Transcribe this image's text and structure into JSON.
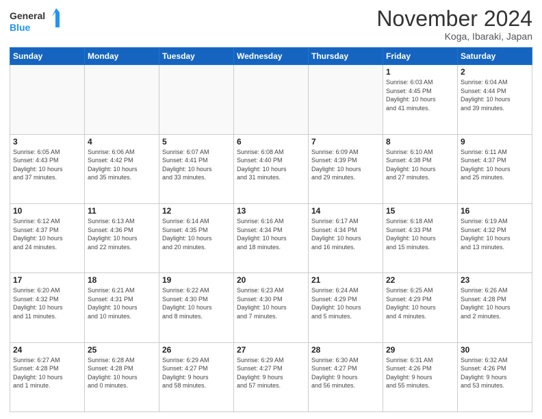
{
  "header": {
    "logo_line1": "General",
    "logo_line2": "Blue",
    "month": "November 2024",
    "location": "Koga, Ibaraki, Japan"
  },
  "weekdays": [
    "Sunday",
    "Monday",
    "Tuesday",
    "Wednesday",
    "Thursday",
    "Friday",
    "Saturday"
  ],
  "weeks": [
    [
      {
        "day": "",
        "info": ""
      },
      {
        "day": "",
        "info": ""
      },
      {
        "day": "",
        "info": ""
      },
      {
        "day": "",
        "info": ""
      },
      {
        "day": "",
        "info": ""
      },
      {
        "day": "1",
        "info": "Sunrise: 6:03 AM\nSunset: 4:45 PM\nDaylight: 10 hours\nand 41 minutes."
      },
      {
        "day": "2",
        "info": "Sunrise: 6:04 AM\nSunset: 4:44 PM\nDaylight: 10 hours\nand 39 minutes."
      }
    ],
    [
      {
        "day": "3",
        "info": "Sunrise: 6:05 AM\nSunset: 4:43 PM\nDaylight: 10 hours\nand 37 minutes."
      },
      {
        "day": "4",
        "info": "Sunrise: 6:06 AM\nSunset: 4:42 PM\nDaylight: 10 hours\nand 35 minutes."
      },
      {
        "day": "5",
        "info": "Sunrise: 6:07 AM\nSunset: 4:41 PM\nDaylight: 10 hours\nand 33 minutes."
      },
      {
        "day": "6",
        "info": "Sunrise: 6:08 AM\nSunset: 4:40 PM\nDaylight: 10 hours\nand 31 minutes."
      },
      {
        "day": "7",
        "info": "Sunrise: 6:09 AM\nSunset: 4:39 PM\nDaylight: 10 hours\nand 29 minutes."
      },
      {
        "day": "8",
        "info": "Sunrise: 6:10 AM\nSunset: 4:38 PM\nDaylight: 10 hours\nand 27 minutes."
      },
      {
        "day": "9",
        "info": "Sunrise: 6:11 AM\nSunset: 4:37 PM\nDaylight: 10 hours\nand 25 minutes."
      }
    ],
    [
      {
        "day": "10",
        "info": "Sunrise: 6:12 AM\nSunset: 4:37 PM\nDaylight: 10 hours\nand 24 minutes."
      },
      {
        "day": "11",
        "info": "Sunrise: 6:13 AM\nSunset: 4:36 PM\nDaylight: 10 hours\nand 22 minutes."
      },
      {
        "day": "12",
        "info": "Sunrise: 6:14 AM\nSunset: 4:35 PM\nDaylight: 10 hours\nand 20 minutes."
      },
      {
        "day": "13",
        "info": "Sunrise: 6:16 AM\nSunset: 4:34 PM\nDaylight: 10 hours\nand 18 minutes."
      },
      {
        "day": "14",
        "info": "Sunrise: 6:17 AM\nSunset: 4:34 PM\nDaylight: 10 hours\nand 16 minutes."
      },
      {
        "day": "15",
        "info": "Sunrise: 6:18 AM\nSunset: 4:33 PM\nDaylight: 10 hours\nand 15 minutes."
      },
      {
        "day": "16",
        "info": "Sunrise: 6:19 AM\nSunset: 4:32 PM\nDaylight: 10 hours\nand 13 minutes."
      }
    ],
    [
      {
        "day": "17",
        "info": "Sunrise: 6:20 AM\nSunset: 4:32 PM\nDaylight: 10 hours\nand 11 minutes."
      },
      {
        "day": "18",
        "info": "Sunrise: 6:21 AM\nSunset: 4:31 PM\nDaylight: 10 hours\nand 10 minutes."
      },
      {
        "day": "19",
        "info": "Sunrise: 6:22 AM\nSunset: 4:30 PM\nDaylight: 10 hours\nand 8 minutes."
      },
      {
        "day": "20",
        "info": "Sunrise: 6:23 AM\nSunset: 4:30 PM\nDaylight: 10 hours\nand 7 minutes."
      },
      {
        "day": "21",
        "info": "Sunrise: 6:24 AM\nSunset: 4:29 PM\nDaylight: 10 hours\nand 5 minutes."
      },
      {
        "day": "22",
        "info": "Sunrise: 6:25 AM\nSunset: 4:29 PM\nDaylight: 10 hours\nand 4 minutes."
      },
      {
        "day": "23",
        "info": "Sunrise: 6:26 AM\nSunset: 4:28 PM\nDaylight: 10 hours\nand 2 minutes."
      }
    ],
    [
      {
        "day": "24",
        "info": "Sunrise: 6:27 AM\nSunset: 4:28 PM\nDaylight: 10 hours\nand 1 minute."
      },
      {
        "day": "25",
        "info": "Sunrise: 6:28 AM\nSunset: 4:28 PM\nDaylight: 10 hours\nand 0 minutes."
      },
      {
        "day": "26",
        "info": "Sunrise: 6:29 AM\nSunset: 4:27 PM\nDaylight: 9 hours\nand 58 minutes."
      },
      {
        "day": "27",
        "info": "Sunrise: 6:29 AM\nSunset: 4:27 PM\nDaylight: 9 hours\nand 57 minutes."
      },
      {
        "day": "28",
        "info": "Sunrise: 6:30 AM\nSunset: 4:27 PM\nDaylight: 9 hours\nand 56 minutes."
      },
      {
        "day": "29",
        "info": "Sunrise: 6:31 AM\nSunset: 4:26 PM\nDaylight: 9 hours\nand 55 minutes."
      },
      {
        "day": "30",
        "info": "Sunrise: 6:32 AM\nSunset: 4:26 PM\nDaylight: 9 hours\nand 53 minutes."
      }
    ]
  ]
}
